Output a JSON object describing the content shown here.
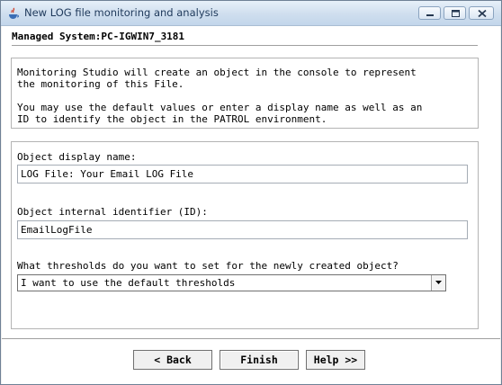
{
  "window": {
    "title": "New LOG file monitoring and analysis",
    "accent": "#c3d6eb"
  },
  "managed_system": "Managed System:PC-IGWIN7_3181",
  "info": {
    "paragraph1_line1": "Monitoring Studio will create an object in the console to represent",
    "paragraph1_line2": "the monitoring of this File.",
    "paragraph2_line1": "You may use the default values or enter a display name as well as an",
    "paragraph2_line2": "ID to identify the object in the PATROL environment."
  },
  "form": {
    "display_name_label": "Object display name:",
    "display_name_value": "LOG File: Your Email LOG File",
    "identifier_label": "Object internal identifier (ID):",
    "identifier_value": "EmailLogFile",
    "thresholds_label": "What thresholds do you want to set for the newly created object?",
    "thresholds_selected": "I want to use the default thresholds"
  },
  "buttons": {
    "back": "< Back",
    "finish": "Finish",
    "help": "Help >>"
  },
  "icons": {
    "app": "java-app-icon",
    "minimize": "minimize-icon",
    "maximize": "maximize-icon",
    "close": "close-icon",
    "dropdown": "chevron-down-icon"
  }
}
